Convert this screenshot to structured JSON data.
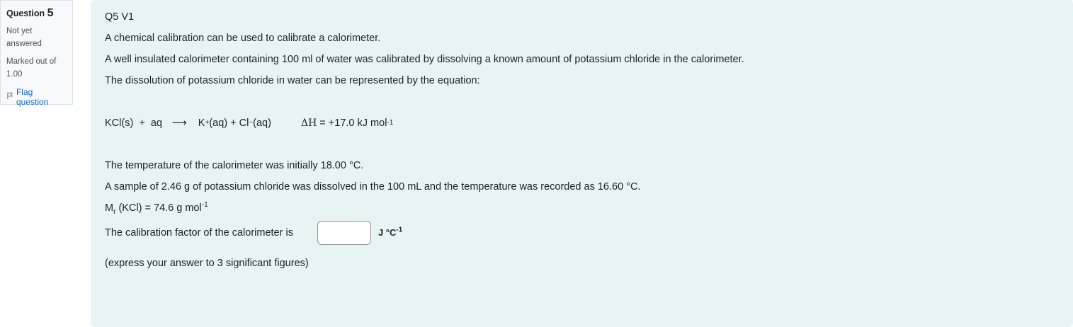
{
  "info": {
    "question_word": "Question",
    "question_number": "5",
    "state": "Not yet answered",
    "grade": "Marked out of 1.00",
    "flag_label": "Flag question"
  },
  "content": {
    "heading": "Q5 V1",
    "para1": "A chemical calibration can be used to calibrate a calorimeter.",
    "para2": "A well insulated calorimeter containing 100 ml of water was calibrated by dissolving a known amount of potassium chloride in the calorimeter.",
    "para3": "The dissolution of potassium chloride in water can be represented by the equation:",
    "equation": {
      "reactants": "KCl(s)  +  aq",
      "arrow": "⟶",
      "k_plus": "K",
      "k_charge": "+",
      "k_state": "(aq) + Cl",
      "cl_charge": "−",
      "cl_state": "(aq)",
      "delta_h": "ΔH",
      "value": " = +17.0 kJ mol",
      "exponent": "-1"
    },
    "para4": "The temperature of the calorimeter was initially 18.00 °C.",
    "para5": "A sample of 2.46 g of potassium chloride was dissolved in the 100 mL and the temperature was recorded as 16.60 °C.",
    "mr": {
      "symbol": "M",
      "subscript": "r",
      "text": " (KCl) = 74.6 g mol",
      "exponent": "-1"
    },
    "answer": {
      "label": "The calibration factor of the calorimeter is",
      "value": "",
      "unit": "J °C",
      "unit_exponent": "-1"
    },
    "note": "(express your answer to 3 significant figures)"
  }
}
